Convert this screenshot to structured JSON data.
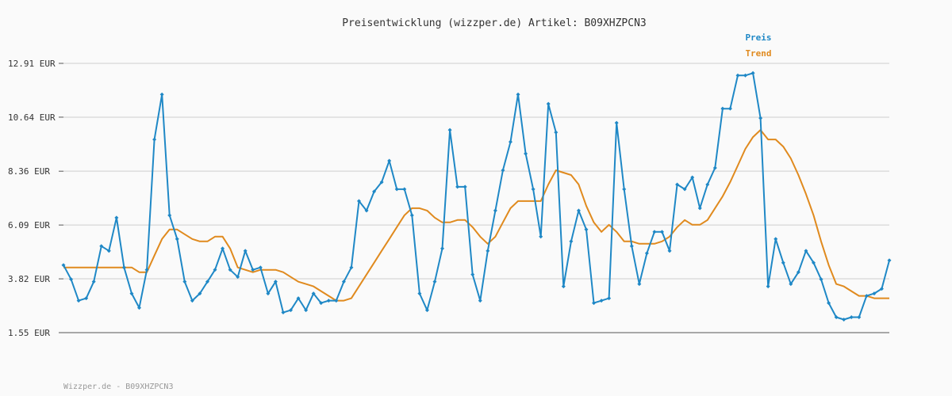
{
  "chart_data": {
    "type": "line",
    "title": "Preisentwicklung (wizzper.de) Artikel: B09XHZPCN3",
    "xlabel": "",
    "ylabel": "",
    "ylim": [
      1.55,
      12.91
    ],
    "yticks": [
      "1.55 EUR",
      "3.82 EUR",
      "6.09 EUR",
      "8.36 EUR",
      "10.64 EUR",
      "12.91 EUR"
    ],
    "ytick_values": [
      1.55,
      3.82,
      6.09,
      8.36,
      10.64,
      12.91
    ],
    "grid": true,
    "legend_position": "top-right",
    "series": [
      {
        "name": "Preis",
        "color": "#1f88c6",
        "values": [
          4.4,
          3.8,
          2.9,
          3.0,
          3.7,
          5.2,
          5.0,
          6.4,
          4.3,
          3.2,
          2.6,
          4.2,
          9.7,
          11.6,
          6.5,
          5.5,
          3.7,
          2.9,
          3.2,
          3.7,
          4.2,
          5.1,
          4.2,
          3.9,
          5.0,
          4.2,
          4.3,
          3.2,
          3.7,
          2.4,
          2.5,
          3.0,
          2.5,
          3.2,
          2.8,
          2.9,
          2.9,
          3.7,
          4.3,
          7.1,
          6.7,
          7.5,
          7.9,
          8.8,
          7.6,
          7.6,
          6.5,
          3.2,
          2.5,
          3.7,
          5.1,
          10.1,
          7.7,
          7.7,
          4.0,
          2.9,
          5.0,
          6.7,
          8.4,
          9.6,
          11.6,
          9.1,
          7.6,
          5.6,
          11.2,
          10.0,
          3.5,
          5.4,
          6.7,
          5.9,
          2.8,
          2.9,
          3.0,
          10.4,
          7.6,
          5.2,
          3.6,
          4.9,
          5.8,
          5.8,
          5.0,
          7.8,
          7.6,
          8.1,
          6.8,
          7.8,
          8.5,
          11.0,
          11.0,
          12.4,
          12.4,
          12.5,
          10.6,
          3.5,
          5.5,
          4.5,
          3.6,
          4.1,
          5.0,
          4.5,
          3.8,
          2.8,
          2.2,
          2.1,
          2.2,
          2.2,
          3.1,
          3.2,
          3.4,
          4.6
        ]
      },
      {
        "name": "Trend",
        "color": "#e08a1e",
        "values": [
          4.3,
          4.3,
          4.3,
          4.3,
          4.3,
          4.3,
          4.3,
          4.3,
          4.3,
          4.3,
          4.1,
          4.1,
          4.8,
          5.5,
          5.9,
          5.9,
          5.7,
          5.5,
          5.4,
          5.4,
          5.6,
          5.6,
          5.1,
          4.3,
          4.2,
          4.1,
          4.2,
          4.2,
          4.2,
          4.1,
          3.9,
          3.7,
          3.6,
          3.5,
          3.3,
          3.1,
          2.9,
          2.9,
          3.0,
          3.5,
          4.0,
          4.5,
          5.0,
          5.5,
          6.0,
          6.5,
          6.8,
          6.8,
          6.7,
          6.4,
          6.2,
          6.2,
          6.3,
          6.3,
          6.0,
          5.6,
          5.3,
          5.6,
          6.2,
          6.8,
          7.1,
          7.1,
          7.1,
          7.1,
          7.8,
          8.4,
          8.3,
          8.2,
          7.8,
          6.9,
          6.2,
          5.8,
          6.1,
          5.8,
          5.4,
          5.4,
          5.3,
          5.3,
          5.3,
          5.4,
          5.6,
          6.0,
          6.3,
          6.1,
          6.1,
          6.3,
          6.8,
          7.3,
          7.9,
          8.6,
          9.3,
          9.8,
          10.1,
          9.7,
          9.7,
          9.4,
          8.9,
          8.2,
          7.4,
          6.5,
          5.4,
          4.4,
          3.6,
          3.5,
          3.3,
          3.1,
          3.1,
          3.0,
          3.0,
          3.0
        ]
      }
    ]
  },
  "footer": "Wizzper.de - B09XHZPCN3"
}
